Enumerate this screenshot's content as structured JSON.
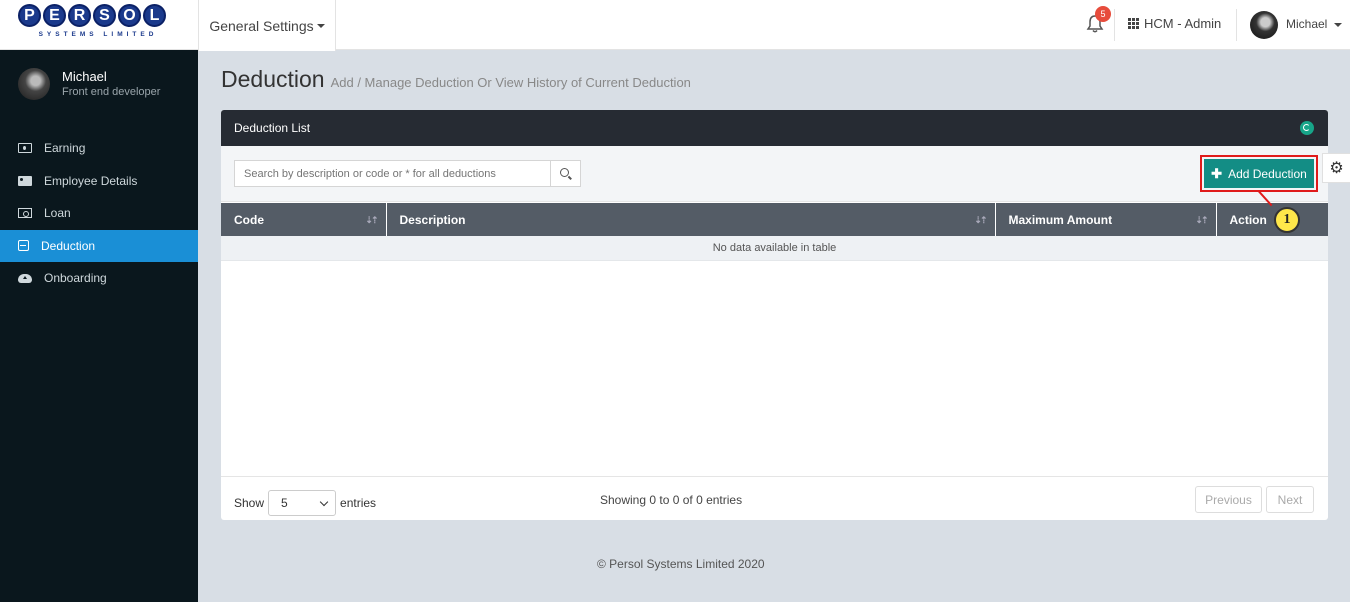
{
  "header": {
    "logo_letters": [
      "P",
      "E",
      "R",
      "S",
      "O",
      "L"
    ],
    "logo_sub": "SYSTEMS LIMITED",
    "general_settings": "General Settings",
    "notification_count": "5",
    "app_label": "HCM - Admin",
    "user_name": "Michael"
  },
  "sidebar": {
    "profile_name": "Michael",
    "profile_role": "Front end developer",
    "items": [
      {
        "label": "Earning",
        "icon": "money-icon"
      },
      {
        "label": "Employee Details",
        "icon": "id-card-icon"
      },
      {
        "label": "Loan",
        "icon": "loan-icon"
      },
      {
        "label": "Deduction",
        "icon": "deduction-icon",
        "active": true
      },
      {
        "label": "Onboarding",
        "icon": "cloud-upload-icon"
      }
    ]
  },
  "page": {
    "title": "Deduction",
    "subtitle": "Add / Manage Deduction Or View History of Current Deduction"
  },
  "panel": {
    "title": "Deduction List",
    "search_placeholder": "Search by description or code or * for all deductions",
    "add_button": "Add Deduction",
    "columns": [
      "Code",
      "Description",
      "Maximum Amount",
      "Action"
    ],
    "empty_message": "No data available in table",
    "show_label": "Show",
    "page_size": "5",
    "entries_label": "entries",
    "showing_text": "Showing 0 to 0 of 0 entries",
    "previous": "Previous",
    "next": "Next"
  },
  "callout_number": "1",
  "footer": {
    "copyright": "© Persol Systems Limited 2020"
  }
}
